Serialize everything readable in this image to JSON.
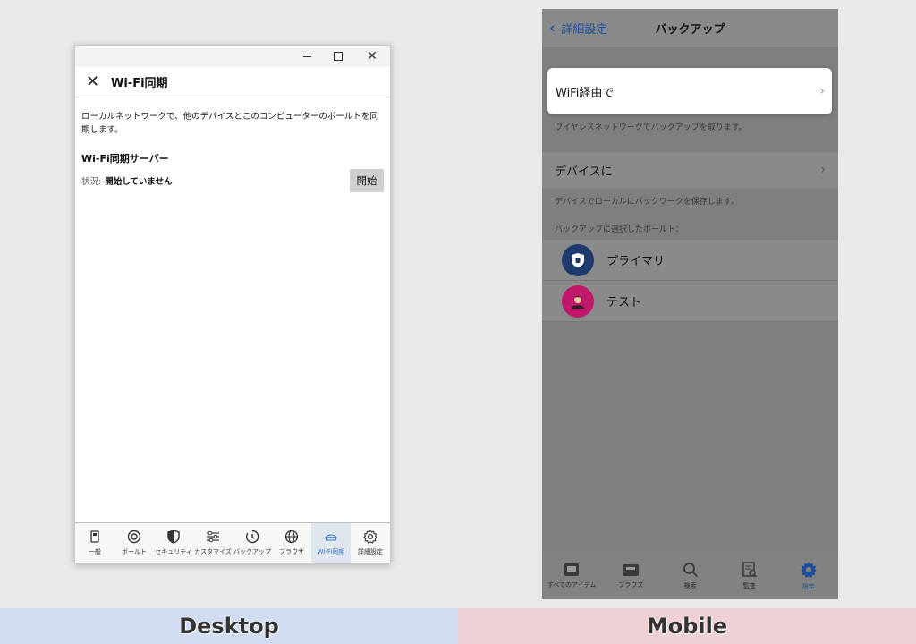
{
  "desktop": {
    "header_title": "Wi-Fi同期",
    "description": "ローカルネットワークで、他のデバイスとこのコンピューターのボールトを同期します。",
    "section_title": "Wi-Fi同期サーバー",
    "status_label": "状況:",
    "status_value": "開始していません",
    "start_button": "開始",
    "tabs": [
      {
        "label": "一般",
        "icon": "phone-icon"
      },
      {
        "label": "ボールト",
        "icon": "vault-icon"
      },
      {
        "label": "セキュリティ",
        "icon": "shield-icon"
      },
      {
        "label": "カスタマイズ",
        "icon": "sliders-icon"
      },
      {
        "label": "バックアップ",
        "icon": "clock-icon"
      },
      {
        "label": "ブラウザ",
        "icon": "globe-icon"
      },
      {
        "label": "Wi-Fi同期",
        "icon": "sync-icon"
      },
      {
        "label": "詳細設定",
        "icon": "gear-icon"
      }
    ],
    "active_tab": "Wi-Fi同期"
  },
  "mobile": {
    "back_label": "詳細設定",
    "nav_title": "バックアップ",
    "wifi_option": "WiFi経由で",
    "wifi_note": "ワイヤレスネットワークでバックアップを取ります。",
    "device_option": "デバイスに",
    "device_note": "デバイスでローカルにバックワークを保存します。",
    "vaults_header": "バックアップに選択したボールト：",
    "vaults": [
      {
        "name": "プライマリ",
        "color": "#1e3a6e"
      },
      {
        "name": "テスト",
        "color": "#c0196b"
      }
    ],
    "tabs": [
      {
        "label": "すべてのアイテム",
        "icon": "items-icon"
      },
      {
        "label": "ブラウズ",
        "icon": "tray-icon"
      },
      {
        "label": "検索",
        "icon": "search-icon"
      },
      {
        "label": "監査",
        "icon": "audit-icon"
      },
      {
        "label": "設定",
        "icon": "gear-icon"
      }
    ],
    "active_tab": "設定",
    "accent_color": "#1b4f9c"
  },
  "labels": {
    "desktop": "Desktop",
    "mobile": "Mobile"
  }
}
